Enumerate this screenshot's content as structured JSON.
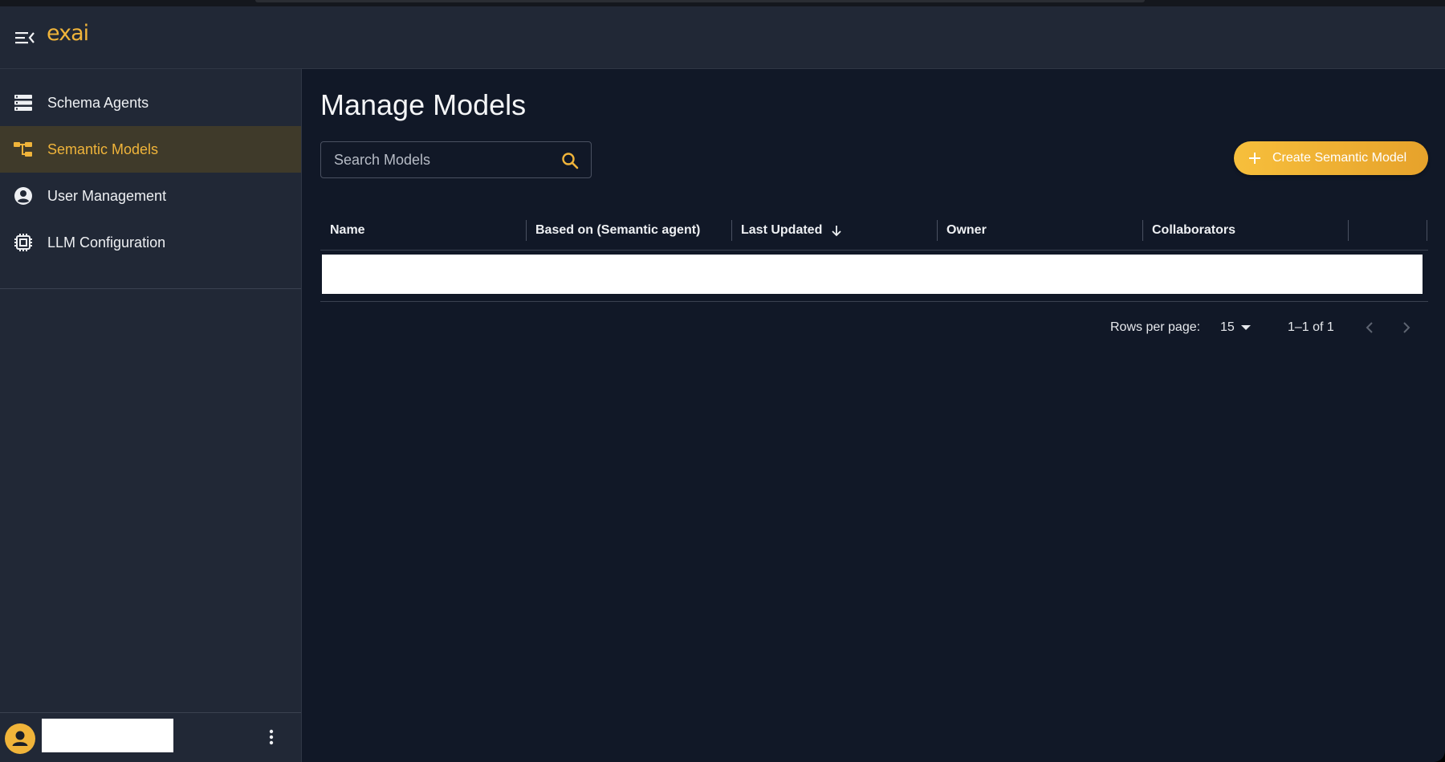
{
  "header": {
    "logo_text": "exai"
  },
  "sidebar": {
    "items": [
      {
        "label": "Schema Agents",
        "icon": "storage-icon",
        "active": false
      },
      {
        "label": "Semantic Models",
        "icon": "schema-tree-icon",
        "active": true
      },
      {
        "label": "User Management",
        "icon": "account-circle-icon",
        "active": false
      },
      {
        "label": "LLM Configuration",
        "icon": "chip-icon",
        "active": false
      }
    ],
    "footer": {
      "username": ""
    }
  },
  "main": {
    "title": "Manage Models",
    "search": {
      "placeholder": "Search Models",
      "value": ""
    },
    "create_button_label": "Create Semantic Model",
    "table": {
      "columns": [
        {
          "label": "Name",
          "sorted": false
        },
        {
          "label": "Based on (Semantic agent)",
          "sorted": false
        },
        {
          "label": "Last Updated",
          "sorted": true,
          "direction": "desc"
        },
        {
          "label": "Owner",
          "sorted": false
        },
        {
          "label": "Collaborators",
          "sorted": false
        }
      ],
      "rows": []
    },
    "pagination": {
      "rows_per_page_label": "Rows per page:",
      "rows_per_page_value": "15",
      "range_text": "1–1 of 1"
    }
  },
  "colors": {
    "accent": "#f0b43a",
    "background": "#111827",
    "panel": "#212836",
    "active_nav": "#3f3a2a"
  }
}
